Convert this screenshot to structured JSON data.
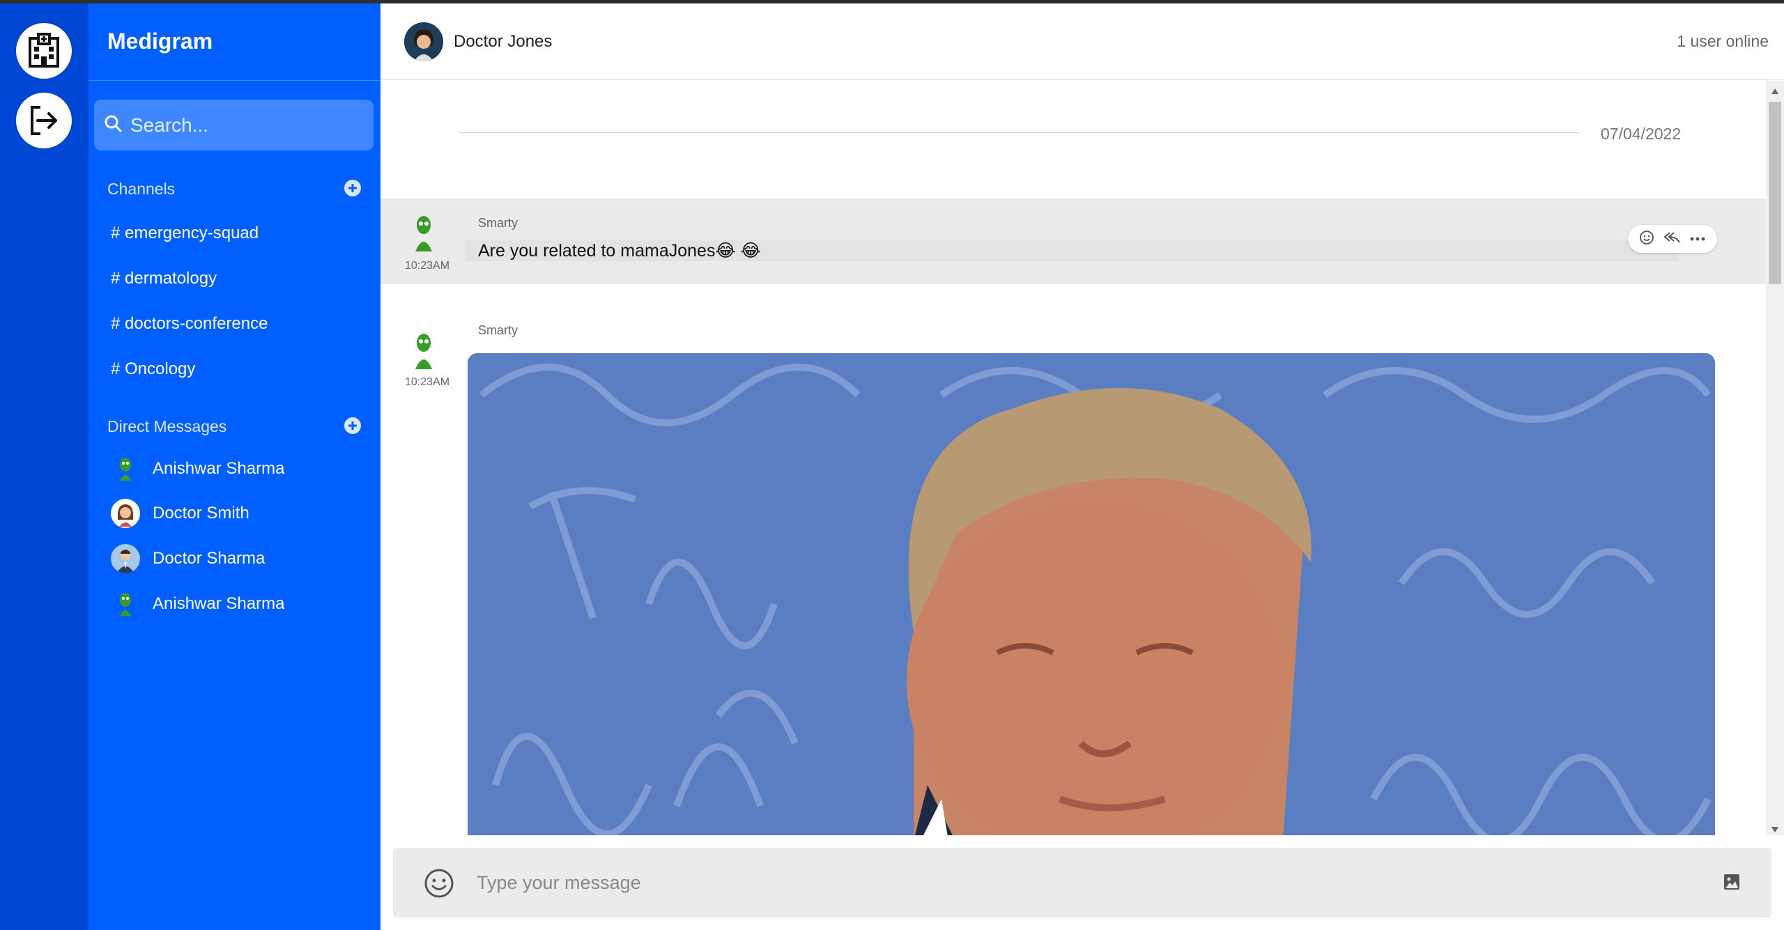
{
  "app": {
    "name": "Medigram"
  },
  "rail": {
    "icons": [
      "hospital-icon",
      "logout-icon"
    ]
  },
  "search": {
    "placeholder": "Search..."
  },
  "channels": {
    "title": "Channels",
    "items": [
      "# emergency-squad",
      "# dermatology",
      "# doctors-conference",
      "# Oncology"
    ]
  },
  "direct_messages": {
    "title": "Direct Messages",
    "items": [
      {
        "name": "Anishwar Sharma",
        "avatar": "alien-avatar"
      },
      {
        "name": "Doctor Smith",
        "avatar": "woman-avatar"
      },
      {
        "name": "Doctor Sharma",
        "avatar": "man-suit-avatar"
      },
      {
        "name": "Anishwar Sharma",
        "avatar": "alien-avatar"
      }
    ]
  },
  "header": {
    "contact_name": "Doctor Jones",
    "online_status": "1 user online"
  },
  "conversation": {
    "date": "07/04/2022",
    "messages": [
      {
        "author": "Smarty",
        "time": "10:23AM",
        "text": "Are you related to mamaJones",
        "emoji": "😂 😂"
      },
      {
        "author": "Smarty",
        "time": "10:23AM",
        "attachment": "gif"
      }
    ]
  },
  "composer": {
    "placeholder": "Type your message"
  },
  "colors": {
    "rail": "#0047d6",
    "sidebar": "#005ffe",
    "search_bg": "#3f87ff",
    "message_hover": "#ebebeb"
  }
}
